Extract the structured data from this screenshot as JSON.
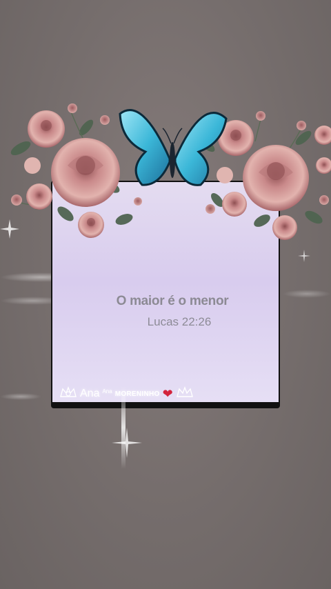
{
  "card": {
    "verse": "O maior é o menor",
    "reference": "Lucas 22:26"
  },
  "signature": {
    "name": "Ana",
    "small_tag": "Ana",
    "brand": "MORENINHO",
    "heart_icon": "heart-icon",
    "crown_icon": "crown-outline-icon"
  },
  "colors": {
    "background": "#7a7170",
    "card_fill": "#dcd2f0",
    "rose": "#c98f8a",
    "butterfly": "#3bb7d8"
  }
}
